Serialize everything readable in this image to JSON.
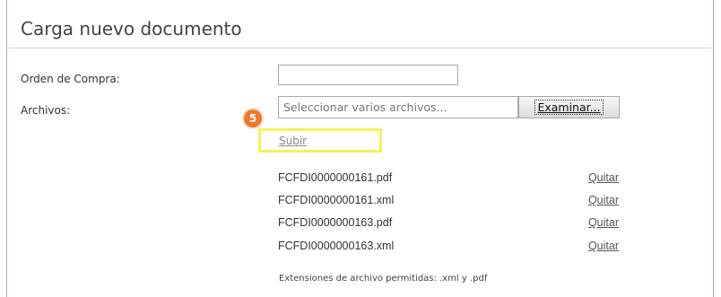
{
  "form": {
    "title": "Carga nuevo documento",
    "purchase_order_label": "Orden de Compra:",
    "purchase_order_value": "",
    "files_label": "Archivos:",
    "file_placeholder": "Seleccionar varios archivos...",
    "browse_label": "Examinar...",
    "step_number": "5",
    "upload_label": "Subir",
    "files": [
      {
        "name": "FCFDI0000000161.pdf",
        "remove_label": "Quitar"
      },
      {
        "name": "FCFDI0000000161.xml",
        "remove_label": "Quitar"
      },
      {
        "name": "FCFDI0000000163.pdf",
        "remove_label": "Quitar"
      },
      {
        "name": "FCFDI0000000163.xml",
        "remove_label": "Quitar"
      }
    ],
    "extensions_note": "Extensiones de archivo permitidas: .xml y .pdf"
  },
  "colors": {
    "step_badge": "#f0782a",
    "highlight": "#f2f25a",
    "panel_border": "#9db4cc"
  }
}
